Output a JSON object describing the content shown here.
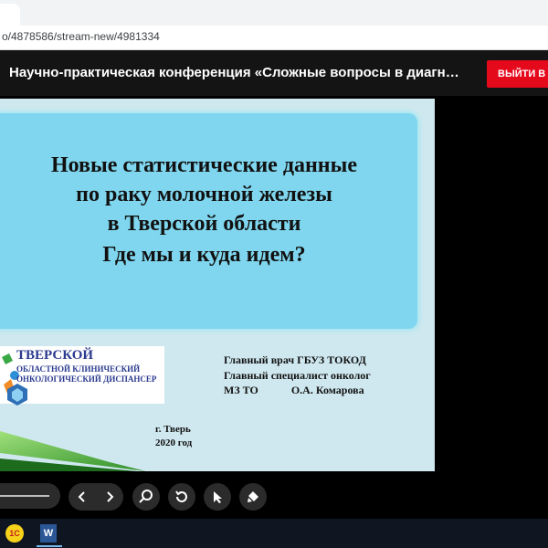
{
  "browser": {
    "url": "o/4878586/stream-new/4981334"
  },
  "header": {
    "title": "Научно-практическая конференция «Сложные вопросы в диагн…",
    "exit_label": "ВЫЙТИ В З"
  },
  "slide": {
    "title_lines": [
      "Новые статистические данные",
      "по раку молочной железы",
      "в Тверской области",
      "Где мы и куда идем?"
    ],
    "logo": {
      "line1": "ТВЕРСКОЙ",
      "line2": "ОБЛАСТНОЙ КЛИНИЧЕСКИЙ",
      "line3": "ОНКОЛОГИЧЕСКИЙ ДИСПАНСЕР"
    },
    "info_lines": [
      "Главный врач ГБУЗ ТОКОД",
      "Главный специалист онколог",
      "МЗ ТО            О.А. Комарова"
    ],
    "city": "г. Тверь",
    "year": "2020 год"
  },
  "controls": {
    "icons": [
      "prev-icon",
      "next-icon",
      "zoom-icon",
      "rotate-icon",
      "pointer-icon",
      "marker-icon"
    ]
  },
  "taskbar": {
    "apps": [
      "1c-icon",
      "word-icon"
    ]
  },
  "colors": {
    "header_bg": "#141414",
    "exit_red": "#e5091c",
    "slide_bg": "#cfe8ef",
    "title_box": "#7fd6ee"
  }
}
